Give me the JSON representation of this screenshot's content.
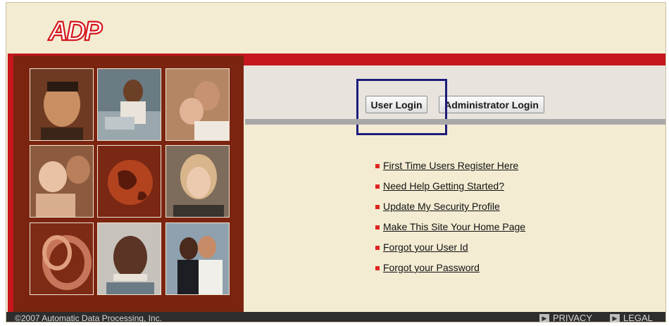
{
  "brand": {
    "logo_text": "ADP"
  },
  "left_panel": {
    "photos": [
      {
        "subject": "man-portrait"
      },
      {
        "subject": "woman-at-laptop"
      },
      {
        "subject": "couple"
      },
      {
        "subject": "parent-with-baby"
      },
      {
        "subject": "globe"
      },
      {
        "subject": "smiling-woman"
      },
      {
        "subject": "abstract-ribbon"
      },
      {
        "subject": "older-man-portrait"
      },
      {
        "subject": "wedding-couple"
      }
    ]
  },
  "login": {
    "user_login_label": "User Login",
    "admin_login_label": "Administrator Login"
  },
  "links": [
    {
      "label": "First Time Users Register Here"
    },
    {
      "label": "Need Help Getting Started?"
    },
    {
      "label": "Update My Security Profile"
    },
    {
      "label": "Make This Site Your Home Page"
    },
    {
      "label": "Forgot your User Id"
    },
    {
      "label": "Forgot your Password"
    }
  ],
  "footer": {
    "copyright": "©2007 Automatic Data Processing, Inc.",
    "privacy_label": "PRIVACY",
    "legal_label": "LEGAL"
  },
  "colors": {
    "brand_red": "#c4161c",
    "panel_brown": "#7b2410",
    "page_bg": "#f3ecd3",
    "footer_bg": "#2d2d2d",
    "highlight_border": "#1d1d7c"
  }
}
